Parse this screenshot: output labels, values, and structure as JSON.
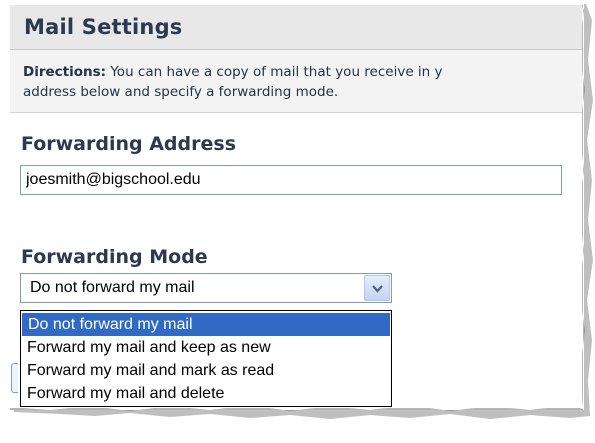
{
  "header": {
    "title": "Mail Settings"
  },
  "directions": {
    "label": "Directions:",
    "line1": " You can have a copy of mail that you receive in y",
    "line2": "address below and specify a forwarding mode."
  },
  "forwarding_address": {
    "label": "Forwarding Address",
    "value": "joesmith@bigschool.edu"
  },
  "forwarding_mode": {
    "label": "Forwarding Mode",
    "selected": "Do not forward my mail",
    "options": [
      {
        "label": "Do not forward my mail",
        "highlighted": true
      },
      {
        "label": "Forward my mail and keep as new",
        "highlighted": false
      },
      {
        "label": "Forward my mail and mark as read",
        "highlighted": false
      },
      {
        "label": "Forward my mail and delete",
        "highlighted": false
      }
    ]
  },
  "colors": {
    "header_bg": "#e8e8e8",
    "heading_text": "#2b3a4f",
    "selection": "#316ac5",
    "input_border": "#7f9db9"
  },
  "icons": {
    "dropdown": "chevron-down-icon"
  }
}
